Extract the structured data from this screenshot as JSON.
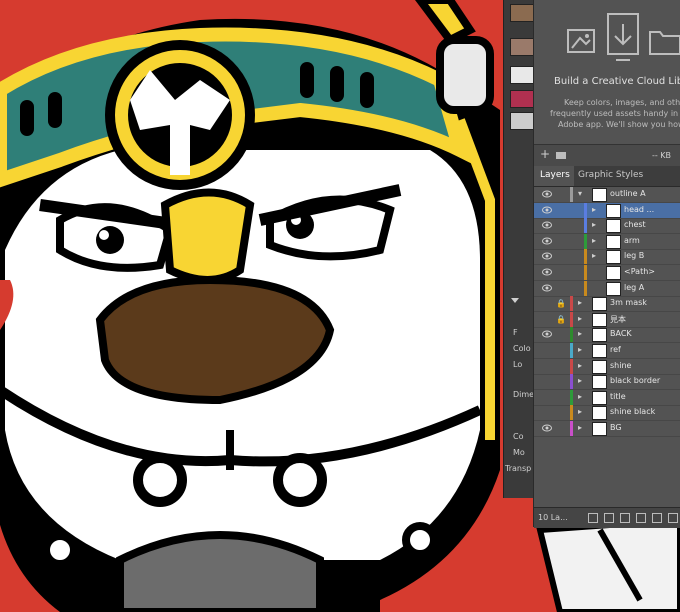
{
  "library": {
    "title": "Build a Creative Cloud Libra",
    "line1": "Keep colors, images, and other",
    "line2": "frequently used assets handy in ev",
    "line3": "Adobe app. We'll show you how",
    "size": "-- KB"
  },
  "tabs": [
    "Layers",
    "Graphic Styles"
  ],
  "properties": [
    "F",
    "Colo",
    "Lo",
    "Dime",
    "Co",
    "Mo",
    "Transp"
  ],
  "layers": [
    {
      "name": "outline A",
      "color": "#9b9b9b",
      "visible": true,
      "expand": "open"
    },
    {
      "name": "head ...",
      "color": "#5a7de0",
      "visible": true,
      "expand": "closed",
      "selected": true
    },
    {
      "name": "chest",
      "color": "#5a7de0",
      "visible": true,
      "expand": "closed"
    },
    {
      "name": "arm",
      "color": "#2d9b3a",
      "visible": true,
      "expand": "closed"
    },
    {
      "name": "leg B",
      "color": "#c98a1e",
      "visible": true,
      "expand": "closed"
    },
    {
      "name": "<Path>",
      "color": "#c98a1e",
      "visible": true,
      "expand": "none"
    },
    {
      "name": "leg A",
      "color": "#c98a1e",
      "visible": true,
      "expand": "none"
    },
    {
      "name": "3m mask",
      "color": "#c94848",
      "visible": false,
      "locked": true,
      "expand": "closed"
    },
    {
      "name": "見本",
      "color": "#c94848",
      "visible": false,
      "locked": true,
      "expand": "closed"
    },
    {
      "name": "BACK",
      "color": "#2e8b2e",
      "visible": true,
      "expand": "closed"
    },
    {
      "name": "ref",
      "color": "#4aa9c9",
      "visible": false,
      "expand": "closed"
    },
    {
      "name": "shine",
      "color": "#c94848",
      "visible": false,
      "expand": "closed"
    },
    {
      "name": "black border",
      "color": "#8b4fd0",
      "visible": false,
      "expand": "closed"
    },
    {
      "name": "title",
      "color": "#2d9b3a",
      "visible": false,
      "expand": "closed"
    },
    {
      "name": "shine black",
      "color": "#c98a1e",
      "visible": false,
      "expand": "closed"
    },
    {
      "name": "BG",
      "color": "#c94fc9",
      "visible": true,
      "expand": "closed"
    }
  ],
  "footer": {
    "count": "10 La..."
  }
}
